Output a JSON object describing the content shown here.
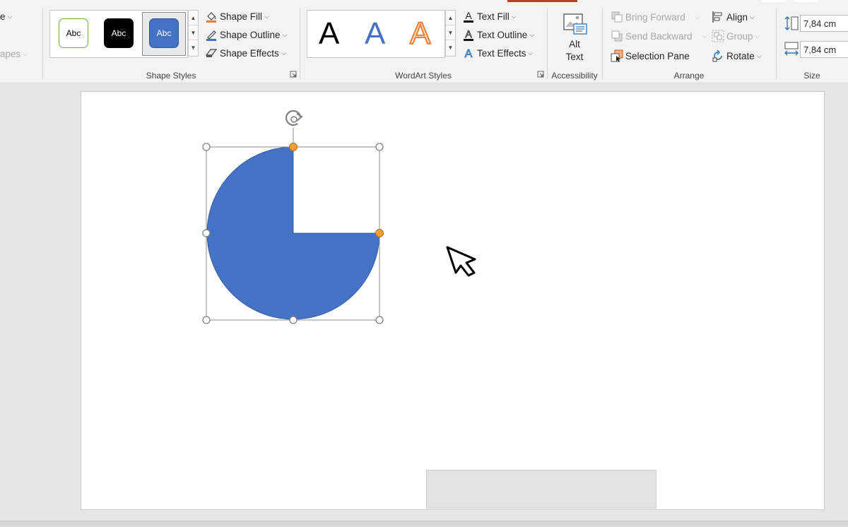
{
  "ribbon": {
    "left_partial": {
      "label_top": "e",
      "label_bottom": "apes"
    },
    "shape_styles": {
      "group_label": "Shape Styles",
      "swatches": [
        {
          "label": "Abc",
          "fill": "#ffffff",
          "text_color": "#000000",
          "border": "#70ad47"
        },
        {
          "label": "Abc",
          "fill": "#000000",
          "text_color": "#ffffff",
          "border": "#000000"
        },
        {
          "label": "Abc",
          "fill": "#4472c4",
          "text_color": "#ffffff",
          "border": "#2f5597",
          "selected": true
        }
      ],
      "shape_fill": "Shape Fill",
      "shape_outline": "Shape Outline",
      "shape_effects": "Shape Effects"
    },
    "wordart_styles": {
      "group_label": "WordArt Styles",
      "letters": [
        {
          "char": "A",
          "style": "black"
        },
        {
          "char": "A",
          "style": "blue"
        },
        {
          "char": "A",
          "style": "orange-outline"
        }
      ],
      "text_fill": "Text Fill",
      "text_outline": "Text Outline",
      "text_effects": "Text Effects"
    },
    "accessibility": {
      "group_label": "Accessibility",
      "alt_text_line1": "Alt",
      "alt_text_line2": "Text"
    },
    "arrange": {
      "group_label": "Arrange",
      "bring_forward": "Bring Forward",
      "send_backward": "Send Backward",
      "selection_pane": "Selection Pane",
      "align": "Align",
      "group": "Group",
      "rotate": "Rotate"
    },
    "size": {
      "group_label": "Size",
      "height": "7,84 cm",
      "width": "7,84 cm"
    }
  },
  "colors": {
    "accent": "#c43e1c",
    "shape_fill": "#4472c4",
    "adjust_handle": "#f0a030"
  }
}
